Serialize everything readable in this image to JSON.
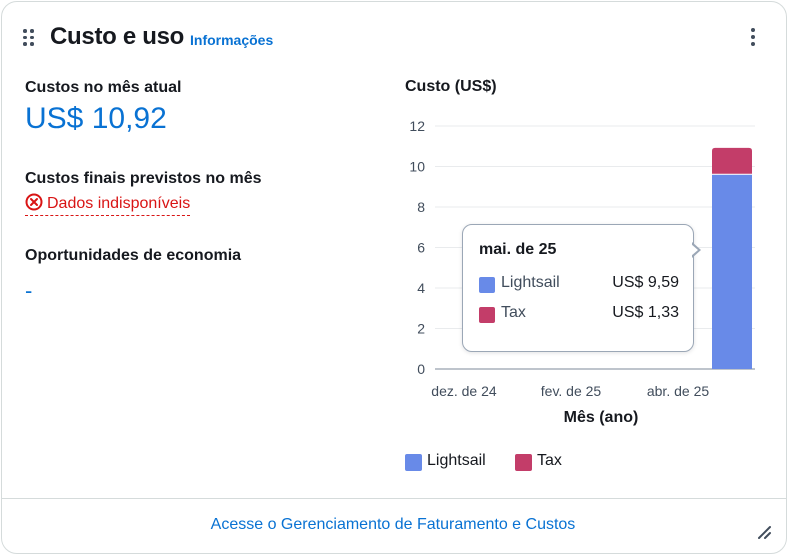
{
  "widget": {
    "title": "Custo e uso",
    "info_link": "Informações"
  },
  "metrics": {
    "current_month_label": "Custos no mês atual",
    "current_month_value": "US$ 10,92",
    "forecast_label": "Custos finais previstos no mês",
    "forecast_value": "Dados indisponíveis",
    "savings_label": "Oportunidades de economia",
    "savings_value": "-"
  },
  "chart_data": {
    "type": "bar",
    "stacked": true,
    "title": "Custo (US$)",
    "xlabel": "Mês (ano)",
    "ylabel": "Custo (US$)",
    "ylim": [
      0,
      12
    ],
    "yticks": [
      0,
      2,
      4,
      6,
      8,
      10,
      12
    ],
    "x_tick_labels": [
      "dez. de 24",
      "fev. de 25",
      "abr. de 25"
    ],
    "categories": [
      "mai. de 25"
    ],
    "series": [
      {
        "name": "Lightsail",
        "color": "#688ae8",
        "values": [
          9.59
        ]
      },
      {
        "name": "Tax",
        "color": "#c33d69",
        "values": [
          1.33
        ]
      }
    ],
    "grid": true,
    "legend_position": "bottom"
  },
  "tooltip": {
    "title": "mai. de 25",
    "rows": [
      {
        "name": "Lightsail",
        "value": "US$ 9,59",
        "color": "#688ae8"
      },
      {
        "name": "Tax",
        "value": "US$ 1,33",
        "color": "#c33d69"
      }
    ]
  },
  "footer": {
    "link": "Acesse o Gerenciamento de Faturamento e Custos"
  },
  "colors": {
    "link": "#0972d3",
    "error": "#d91515"
  }
}
